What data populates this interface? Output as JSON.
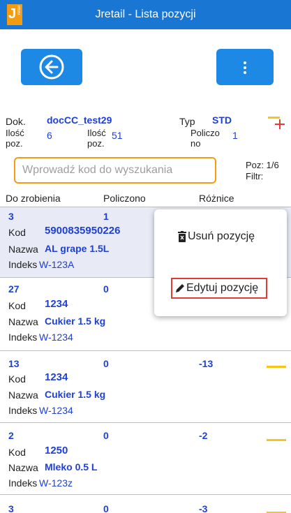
{
  "app": {
    "logo_text": "J",
    "logo_subtext": "retail",
    "title": "Jretail - Lista pozycji"
  },
  "icons": {
    "back": "arrow-left-circle-icon",
    "menu": "vertical-dots-icon",
    "trash": "trash-icon",
    "pencil": "pencil-icon"
  },
  "colors": {
    "titlebar": "#1976d2",
    "button": "#1e88e5",
    "accent": "#f39c12",
    "value_blue": "#1e40d6",
    "minus": "#f5c518",
    "plus": "#e53935"
  },
  "document": {
    "dok_label": "Dok.",
    "dok_value": "docCC_test29",
    "typ_label": "Typ",
    "typ_value": "STD",
    "ilosc_poz_label_1": "Ilość",
    "ilosc_poz_label_2": "poz.",
    "ilosc_poz_value": "6",
    "ilosc_label_1": "Ilość",
    "ilosc_label_2": "poz.",
    "ilosc_value": "51",
    "policzono_label_1": "Policzo",
    "policzono_label_2": "no",
    "policzono_value": "1"
  },
  "search": {
    "placeholder": "Wprowadź kod do wyszukania",
    "poz": "Poz: 1/6",
    "filtr": "Filtr:"
  },
  "columns": {
    "todo": "Do zrobienia",
    "counted": "Policzono",
    "diff": "Różnice"
  },
  "labels": {
    "kod": "Kod",
    "nazwa": "Nazwa",
    "indeks": "Indeks"
  },
  "items": [
    {
      "todo": "3",
      "counted": "1",
      "diff": "",
      "kod": "5900835950226",
      "nazwa": "AL grape 1.5L",
      "indeks": "W-123A"
    },
    {
      "todo": "27",
      "counted": "0",
      "diff": "",
      "kod": "1234",
      "nazwa": "Cukier 1.5 kg",
      "indeks": "W-1234"
    },
    {
      "todo": "13",
      "counted": "0",
      "diff": "-13",
      "kod": "1234",
      "nazwa": "Cukier 1.5 kg",
      "indeks": "W-1234"
    },
    {
      "todo": "2",
      "counted": "0",
      "diff": "-2",
      "kod": "1250",
      "nazwa": "Mleko 0.5 L",
      "indeks": "W-123z"
    },
    {
      "todo": "3",
      "counted": "0",
      "diff": "-3"
    }
  ],
  "popup": {
    "delete": "Usuń pozycję",
    "edit": "Edytuj pozycję"
  }
}
